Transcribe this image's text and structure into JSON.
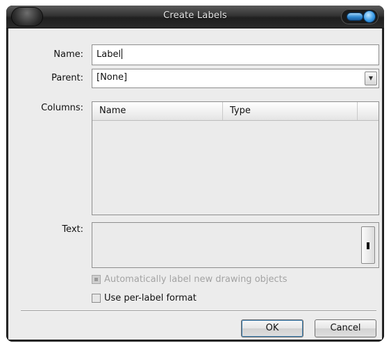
{
  "window": {
    "title": "Create Labels"
  },
  "form": {
    "name_label": "Name:",
    "name_value": "Label",
    "parent_label": "Parent:",
    "parent_value": "[None]",
    "columns_label": "Columns:",
    "columns_headers": [
      "Name",
      "Type"
    ],
    "text_label": "Text:",
    "auto_label_text": "Automatically label new drawing objects",
    "auto_label_enabled": false,
    "per_label_text": "Use per-label format",
    "per_label_checked": false
  },
  "buttons": {
    "ok": "OK",
    "cancel": "Cancel"
  },
  "icons": {
    "dropdown": "chevron-down-icon",
    "minimize": "minimize-icon",
    "close": "close-icon"
  }
}
